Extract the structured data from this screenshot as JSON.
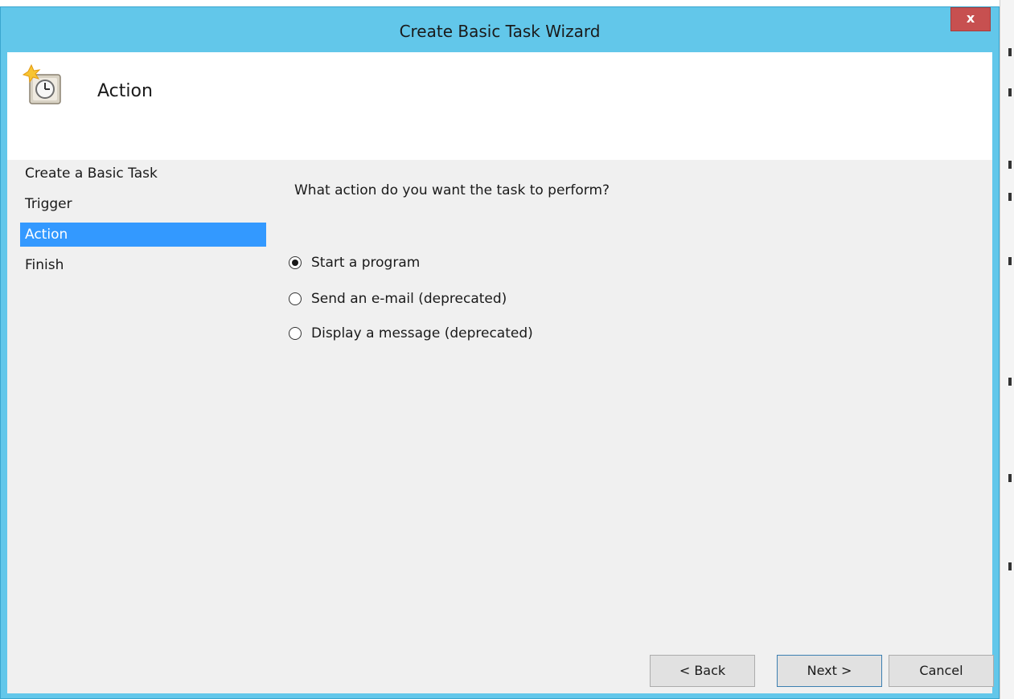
{
  "window": {
    "title": "Create Basic Task Wizard",
    "close_label": "x"
  },
  "header": {
    "title": "Action",
    "icon": "task-scheduler-clock-icon"
  },
  "nav": {
    "items": [
      {
        "label": "Create a Basic Task",
        "selected": false
      },
      {
        "label": "Trigger",
        "selected": false
      },
      {
        "label": "Action",
        "selected": true
      },
      {
        "label": "Finish",
        "selected": false
      }
    ]
  },
  "content": {
    "question": "What action do you want the task to perform?",
    "options": [
      {
        "label": "Start a program",
        "checked": true
      },
      {
        "label": "Send an e-mail (deprecated)",
        "checked": false
      },
      {
        "label": "Display a message (deprecated)",
        "checked": false
      }
    ]
  },
  "buttons": {
    "back": "< Back",
    "next": "Next >",
    "cancel": "Cancel"
  },
  "colors": {
    "titlebar": "#62c7ea",
    "close": "#c75050",
    "selection": "#3399ff"
  }
}
